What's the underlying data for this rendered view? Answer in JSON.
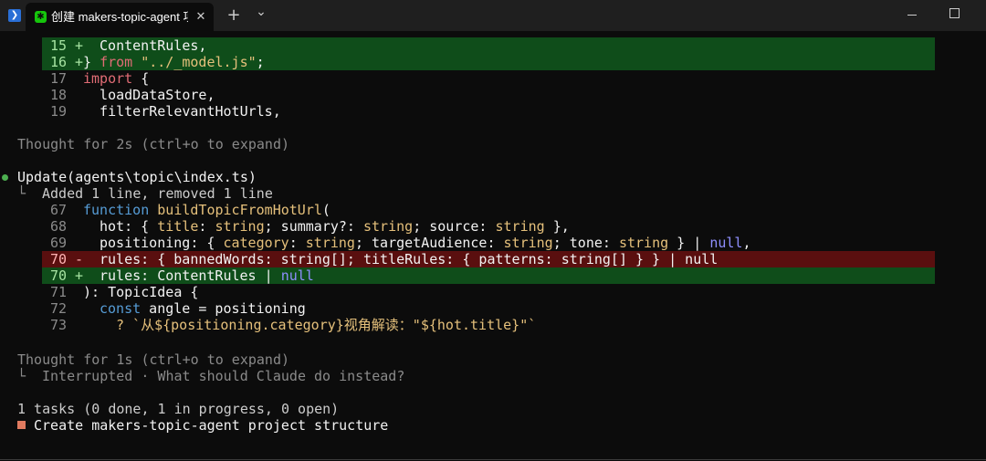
{
  "window": {
    "tab_title": "创建 makers-topic-agent 项目",
    "new_tab_label": "+",
    "dropdown_label": "⌄",
    "close_tab_label": "✕"
  },
  "diff_top": [
    {
      "num": "15",
      "sign": "+",
      "code": " ContentRules,"
    },
    {
      "num": "16",
      "sign": "+",
      "code_pre": "} ",
      "kw_from": "from",
      "code_mid": " ",
      "string": "\"../_model.js\"",
      "code_post": ";"
    },
    {
      "num": "17",
      "sign": " ",
      "kw_import": "import",
      "code": " {"
    },
    {
      "num": "18",
      "sign": " ",
      "code": "  loadDataStore,"
    },
    {
      "num": "19",
      "sign": " ",
      "code": "  filterRelevantHotUrls,"
    }
  ],
  "thought1": "Thought for 2s (ctrl+o to expand)",
  "update": {
    "title": "Update(agents\\topic\\index.ts)",
    "summary": "Added 1 line, removed 1 line"
  },
  "diff_main": {
    "l67": {
      "num": "67",
      "kw": "function",
      "name": "buildTopicFromHotUrl",
      "rest": "("
    },
    "l68": {
      "num": "68",
      "a": "hot: { ",
      "t1": "title",
      "b": ": ",
      "s1": "string",
      "c": "; summary?: ",
      "s2": "string",
      "d": "; source: ",
      "s3": "string",
      "e": " },"
    },
    "l69": {
      "num": "69",
      "a": "positioning: { ",
      "t1": "category",
      "b": ": ",
      "s1": "string",
      "c": "; targetAudience: ",
      "s2": "string",
      "d": "; tone: ",
      "s3": "string",
      "e": " } | ",
      "nul": "null",
      "f": ","
    },
    "l70_del": {
      "num": "70",
      "sign": "-",
      "code": "rules: { bannedWords: string[]; titleRules: { patterns: string[] } } | null"
    },
    "l70_add": {
      "num": "70",
      "sign": "+",
      "a": "rules: ContentRules | ",
      "nul": "null"
    },
    "l71": {
      "num": "71",
      "code": "): TopicIdea {"
    },
    "l72": {
      "num": "72",
      "kw": "const",
      "rest": " angle = positioning"
    },
    "l73": {
      "num": "73",
      "code": "? `从${positioning.category}视角解读：\"${hot.title}\"`"
    }
  },
  "thought2": "Thought for 1s (ctrl+o to expand)",
  "interrupted": "Interrupted · What should Claude do instead?",
  "tasks": {
    "summary": "1 tasks (0 done, 1 in progress, 0 open)",
    "item": "Create makers-topic-agent project structure"
  },
  "tree_glyph": "└",
  "colors": {
    "add_bg": "#0f4d1a",
    "del_bg": "#5a0f0f",
    "keyword": "#c678dd",
    "string": "#e5c07b",
    "null": "#8f8fff",
    "status_green": "#4caf50",
    "task_orange": "#e07a5f"
  }
}
